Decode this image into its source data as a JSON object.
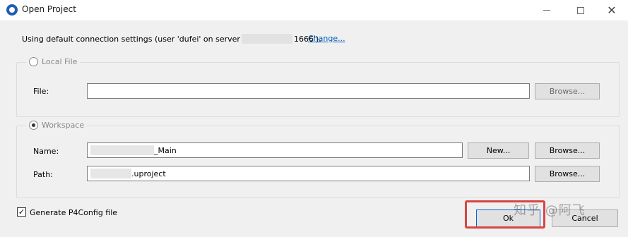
{
  "window": {
    "title": "Open Project",
    "app_icon": "unreal-logo-icon",
    "controls": {
      "minimize": "minimize-icon",
      "maximize": "maximize-icon",
      "close": "✕"
    }
  },
  "connection": {
    "text_before": "Using default connection settings (user 'dufei' on server",
    "text_after": "1666').",
    "change_link": "Change..."
  },
  "local_file": {
    "radio_label": "Local File",
    "selected": false,
    "file_label": "File:",
    "file_value": "",
    "browse_label": "Browse..."
  },
  "workspace": {
    "radio_label": "Workspace",
    "selected": true,
    "name_label": "Name:",
    "name_value": "_Main",
    "new_label": "New...",
    "name_browse_label": "Browse...",
    "path_label": "Path:",
    "path_value": ".uproject",
    "path_browse_label": "Browse..."
  },
  "generate_config": {
    "label": "Generate P4Config file",
    "checked": true,
    "check_mark": "✓"
  },
  "footer": {
    "ok_label": "Ok",
    "cancel_label": "Cancel",
    "highlight_color": "#d64541"
  },
  "watermark": "知乎 @阿飞"
}
